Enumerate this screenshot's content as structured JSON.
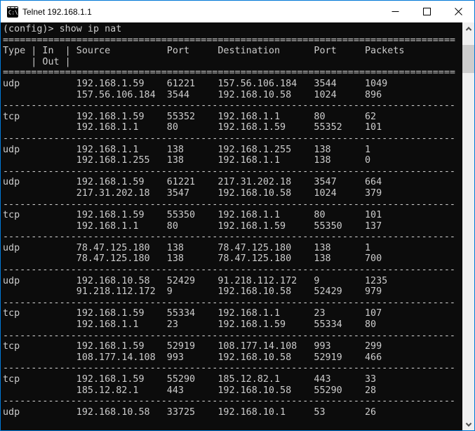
{
  "window": {
    "title": "Telnet 192.168.1.1",
    "controls": {
      "minimize": "minimize",
      "maximize": "maximize",
      "close": "close"
    }
  },
  "colors": {
    "accent_border": "#0078d7",
    "titlebar_bg": "#ffffff",
    "titlebar_text": "#000000",
    "terminal_bg": "#0c0c0c",
    "terminal_text": "#cccccc",
    "scrollbar_track": "#f0f0f0",
    "scrollbar_thumb": "#cdcdcd",
    "scrollbar_arrow": "#505050"
  },
  "icons": {
    "app": "console-prompt-icon",
    "scroll_up": "chevron-up-icon",
    "scroll_down": "chevron-down-icon"
  },
  "terminal": {
    "command_line": "(config)> show ip nat",
    "width_chars": 80,
    "heavy_separator_char": "=",
    "entry_separator_char": "-",
    "header": {
      "row1": {
        "offsets": [
          0,
          5,
          7,
          11,
          13,
          29,
          38,
          55,
          64
        ],
        "cells": [
          "Type",
          "|",
          "In",
          "|",
          "Source",
          "Port",
          "Destination",
          "Port",
          "Packets"
        ]
      },
      "row2": {
        "offsets": [
          5,
          7,
          11
        ],
        "cells": [
          "|",
          "Out",
          "|"
        ]
      }
    },
    "column_offsets": [
      0,
      13,
      29,
      38,
      55,
      64
    ],
    "nat_entries": [
      {
        "type": "udp",
        "in": [
          "192.168.1.59",
          "61221",
          "157.56.106.184",
          "3544",
          "1049"
        ],
        "out": [
          "157.56.106.184",
          "3544",
          "192.168.10.58",
          "1024",
          "896"
        ]
      },
      {
        "type": "tcp",
        "in": [
          "192.168.1.59",
          "55352",
          "192.168.1.1",
          "80",
          "62"
        ],
        "out": [
          "192.168.1.1",
          "80",
          "192.168.1.59",
          "55352",
          "101"
        ]
      },
      {
        "type": "udp",
        "in": [
          "192.168.1.1",
          "138",
          "192.168.1.255",
          "138",
          "1"
        ],
        "out": [
          "192.168.1.255",
          "138",
          "192.168.1.1",
          "138",
          "0"
        ]
      },
      {
        "type": "udp",
        "in": [
          "192.168.1.59",
          "61221",
          "217.31.202.18",
          "3547",
          "664"
        ],
        "out": [
          "217.31.202.18",
          "3547",
          "192.168.10.58",
          "1024",
          "379"
        ]
      },
      {
        "type": "tcp",
        "in": [
          "192.168.1.59",
          "55350",
          "192.168.1.1",
          "80",
          "101"
        ],
        "out": [
          "192.168.1.1",
          "80",
          "192.168.1.59",
          "55350",
          "137"
        ]
      },
      {
        "type": "udp",
        "in": [
          "78.47.125.180",
          "138",
          "78.47.125.180",
          "138",
          "1"
        ],
        "out": [
          "78.47.125.180",
          "138",
          "78.47.125.180",
          "138",
          "700"
        ]
      },
      {
        "type": "udp",
        "in": [
          "192.168.10.58",
          "52429",
          "91.218.112.172",
          "9",
          "1235"
        ],
        "out": [
          "91.218.112.172",
          "9",
          "192.168.10.58",
          "52429",
          "979"
        ]
      },
      {
        "type": "tcp",
        "in": [
          "192.168.1.59",
          "55334",
          "192.168.1.1",
          "23",
          "107"
        ],
        "out": [
          "192.168.1.1",
          "23",
          "192.168.1.59",
          "55334",
          "80"
        ]
      },
      {
        "type": "tcp",
        "in": [
          "192.168.1.59",
          "52919",
          "108.177.14.108",
          "993",
          "299"
        ],
        "out": [
          "108.177.14.108",
          "993",
          "192.168.10.58",
          "52919",
          "466"
        ]
      },
      {
        "type": "tcp",
        "in": [
          "192.168.1.59",
          "55290",
          "185.12.82.1",
          "443",
          "33"
        ],
        "out": [
          "185.12.82.1",
          "443",
          "192.168.10.58",
          "55290",
          "28"
        ]
      },
      {
        "type": "udp",
        "in": [
          "192.168.10.58",
          "33725",
          "192.168.10.1",
          "53",
          "26"
        ],
        "out": null
      }
    ]
  },
  "scrollbar": {
    "orientation": "vertical",
    "thumb_position": "near-top"
  }
}
